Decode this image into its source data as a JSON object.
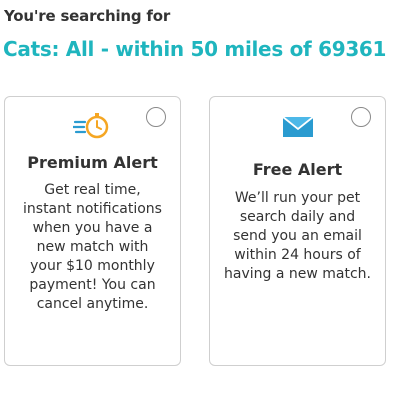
{
  "search": {
    "intro": "You're searching for",
    "criteria": "Cats: All - within 50 miles of 69361"
  },
  "alerts": [
    {
      "icon": "stopwatch-icon",
      "title": "Premium Alert",
      "description": "Get real time, instant notifications when you have a new match with your $10 monthly payment! You can cancel anytime.",
      "selected": false
    },
    {
      "icon": "envelope-icon",
      "title": "Free Alert",
      "description": "We’ll run your pet search daily and send you an email within 24 hours of having a new match.",
      "selected": false
    }
  ],
  "colors": {
    "accent": "#1fb5be",
    "icon_orange": "#f5a623",
    "envelope_blue": "#2a9bd0"
  }
}
